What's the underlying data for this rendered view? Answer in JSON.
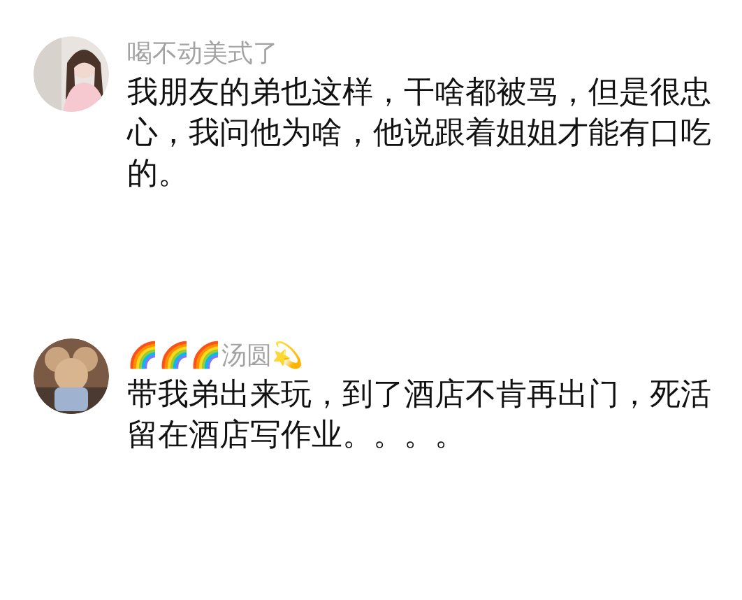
{
  "comments": [
    {
      "avatar": {
        "kind": "picture"
      },
      "username": "喝不动美式了",
      "lines": [
        "我朋友的弟也这样，干啥都被骂，但是很忠",
        "心，我问他为啥，他说跟着姐姐才能有口吃",
        "的。"
      ]
    },
    {
      "avatar": {
        "kind": "picture"
      },
      "username": "🌈🌈🌈汤圆💫",
      "lines": [
        "带我弟出来玩，到了酒店不肯再出门，死活",
        "留在酒店写作业。。。。"
      ]
    }
  ]
}
